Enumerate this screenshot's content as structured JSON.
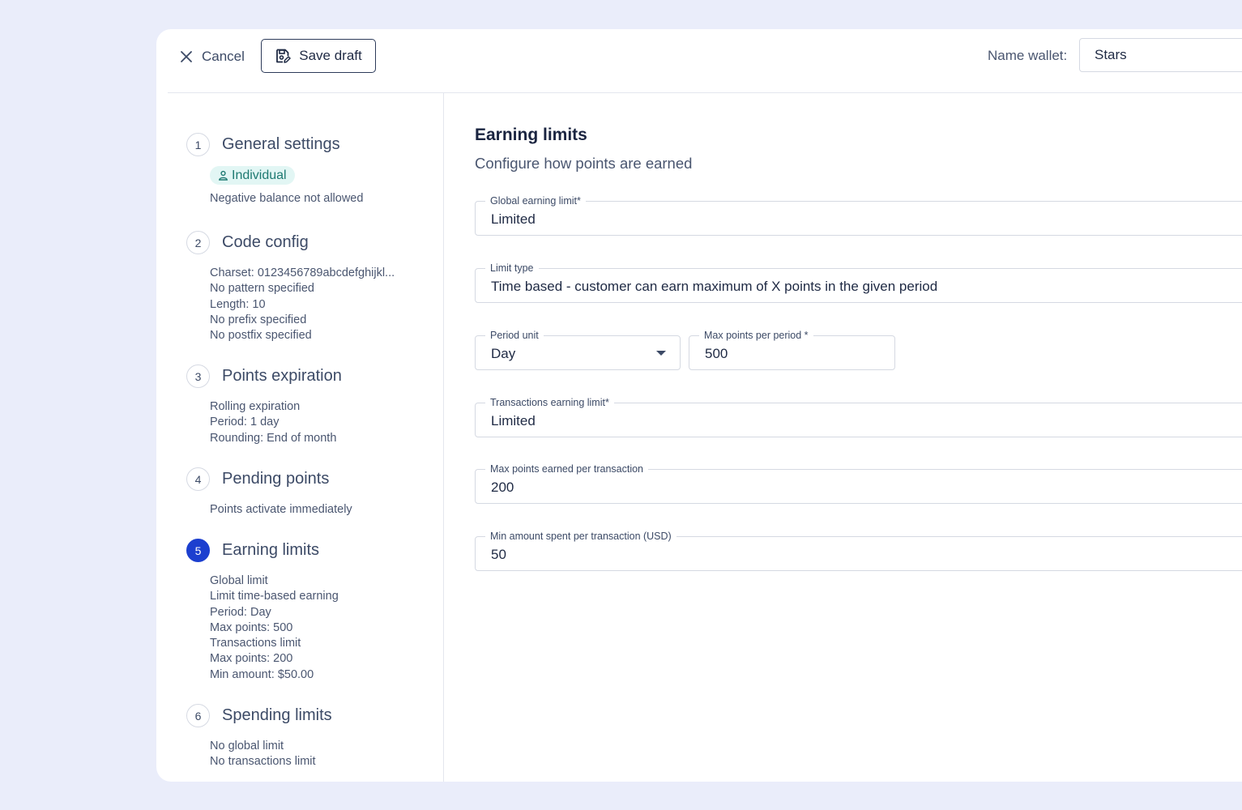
{
  "header": {
    "cancel_label": "Cancel",
    "save_draft_label": "Save draft",
    "name_wallet_label": "Name wallet:",
    "name_wallet_value": "Stars"
  },
  "sidebar": {
    "steps": [
      {
        "number": "1",
        "title": "General settings",
        "badge": "Individual",
        "details": [
          "Negative balance not allowed"
        ]
      },
      {
        "number": "2",
        "title": "Code config",
        "details": [
          "Charset: 0123456789abcdefghijkl...",
          "No pattern specified",
          "Length: 10",
          "No prefix specified",
          "No postfix specified"
        ]
      },
      {
        "number": "3",
        "title": "Points expiration",
        "details": [
          "Rolling expiration",
          "Period: 1 day",
          "Rounding: End of month"
        ]
      },
      {
        "number": "4",
        "title": "Pending points",
        "details": [
          "Points activate immediately"
        ]
      },
      {
        "number": "5",
        "title": "Earning limits",
        "active": true,
        "details": [
          "Global limit",
          "Limit time-based earning",
          "Period: Day",
          "Max points: 500",
          "Transactions limit",
          "Max points: 200",
          "Min amount: $50.00"
        ]
      },
      {
        "number": "6",
        "title": "Spending limits",
        "details": [
          "No global limit",
          "No transactions limit"
        ]
      }
    ]
  },
  "main": {
    "title": "Earning limits",
    "subtitle": "Configure how points are earned",
    "fields": {
      "global_limit": {
        "label": "Global earning limit*",
        "value": "Limited"
      },
      "limit_type": {
        "label": "Limit type",
        "value": "Time based - customer can earn maximum of X points in the given period"
      },
      "period_unit": {
        "label": "Period unit",
        "value": "Day"
      },
      "max_points_period": {
        "label": "Max points per period *",
        "value": "500"
      },
      "transactions_limit": {
        "label": "Transactions earning limit*",
        "value": "Limited"
      },
      "max_points_transaction": {
        "label": "Max points earned per transaction",
        "value": "200"
      },
      "min_amount": {
        "label": "Min amount spent per transaction (USD)",
        "value": "50"
      }
    }
  },
  "colors": {
    "accent": "#1c3fcf",
    "page_bg": "#eaedfa",
    "badge_bg": "#e2f6f4",
    "badge_text": "#1e7a72"
  }
}
